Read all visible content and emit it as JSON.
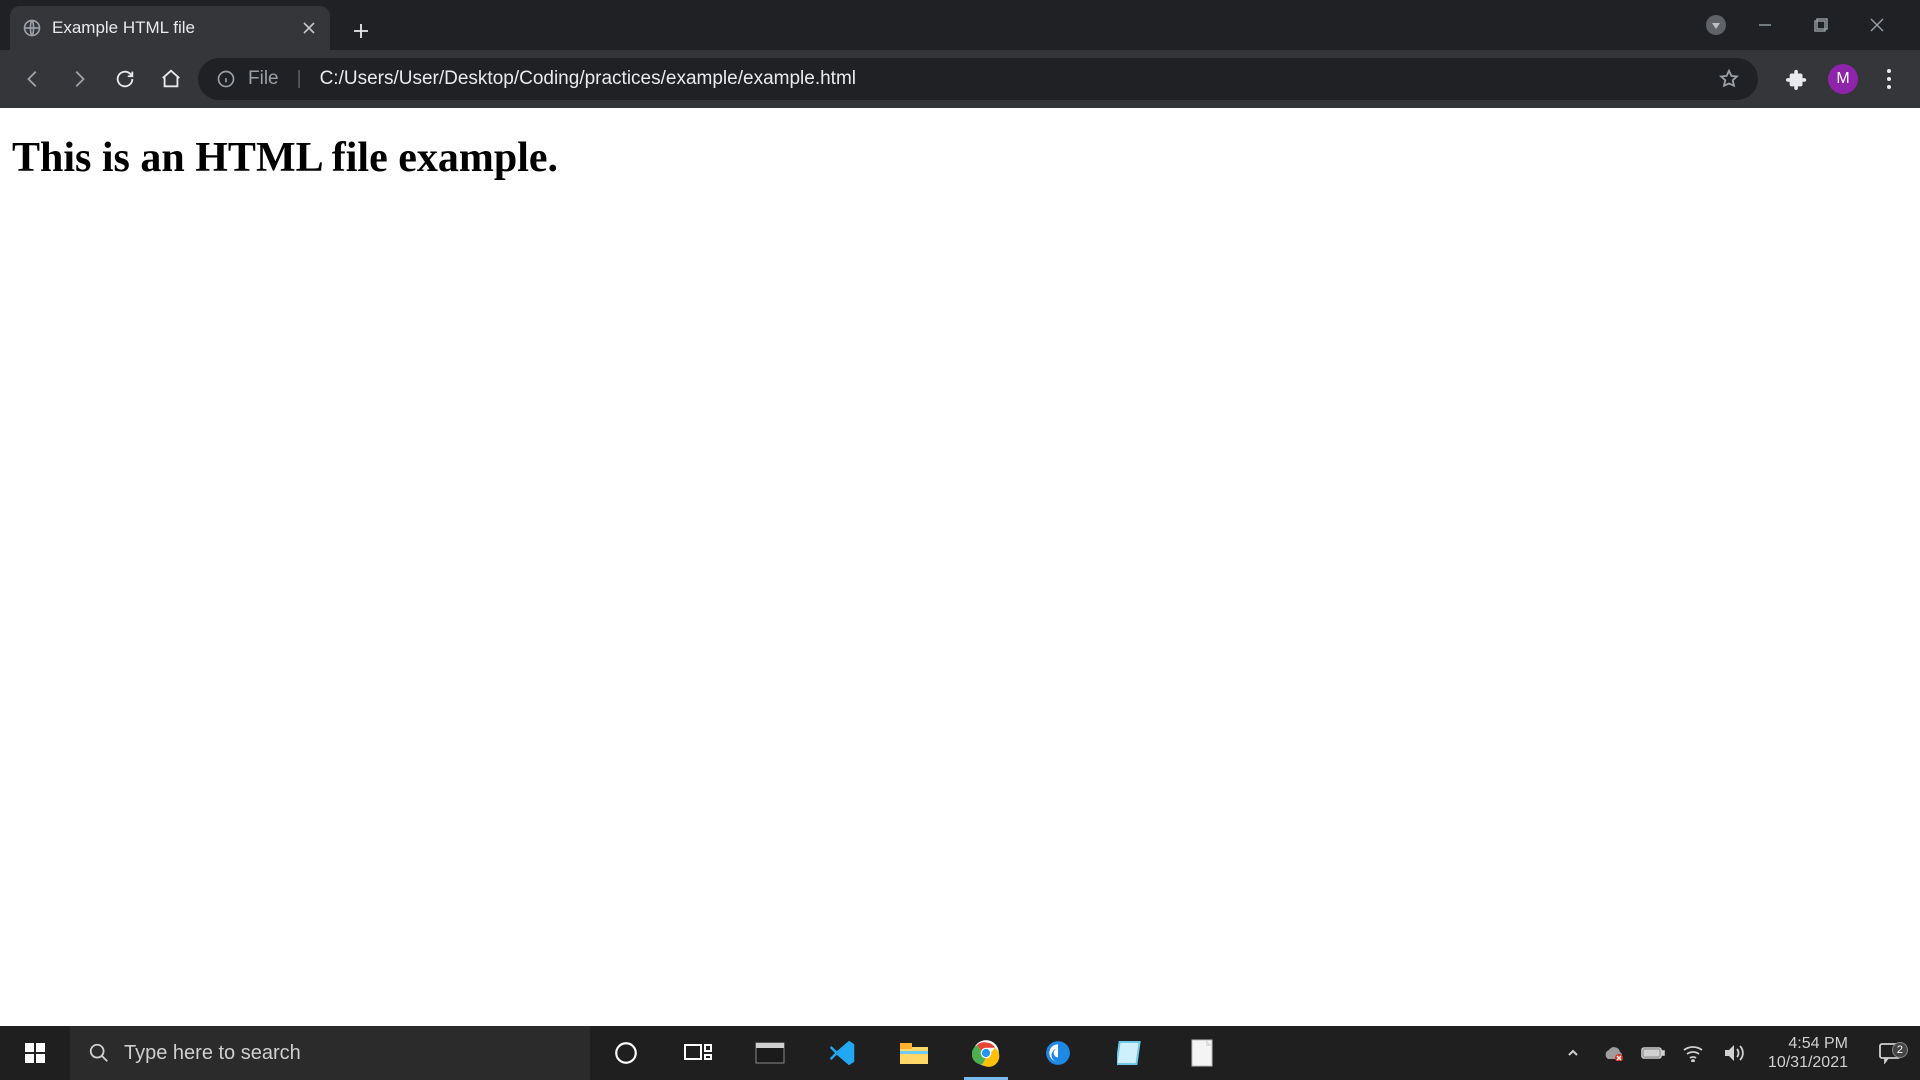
{
  "window_controls": {
    "account_present": true
  },
  "tab": {
    "title": "Example HTML file"
  },
  "omnibox": {
    "scheme": "File",
    "path": "C:/Users/User/Desktop/Coding/practices/example/example.html"
  },
  "profile": {
    "initial": "M"
  },
  "page": {
    "heading": "This is an HTML file example."
  },
  "taskbar": {
    "search_placeholder": "Type here to search",
    "clock_time": "4:54 PM",
    "clock_date": "10/31/2021",
    "action_center_count": "2"
  }
}
